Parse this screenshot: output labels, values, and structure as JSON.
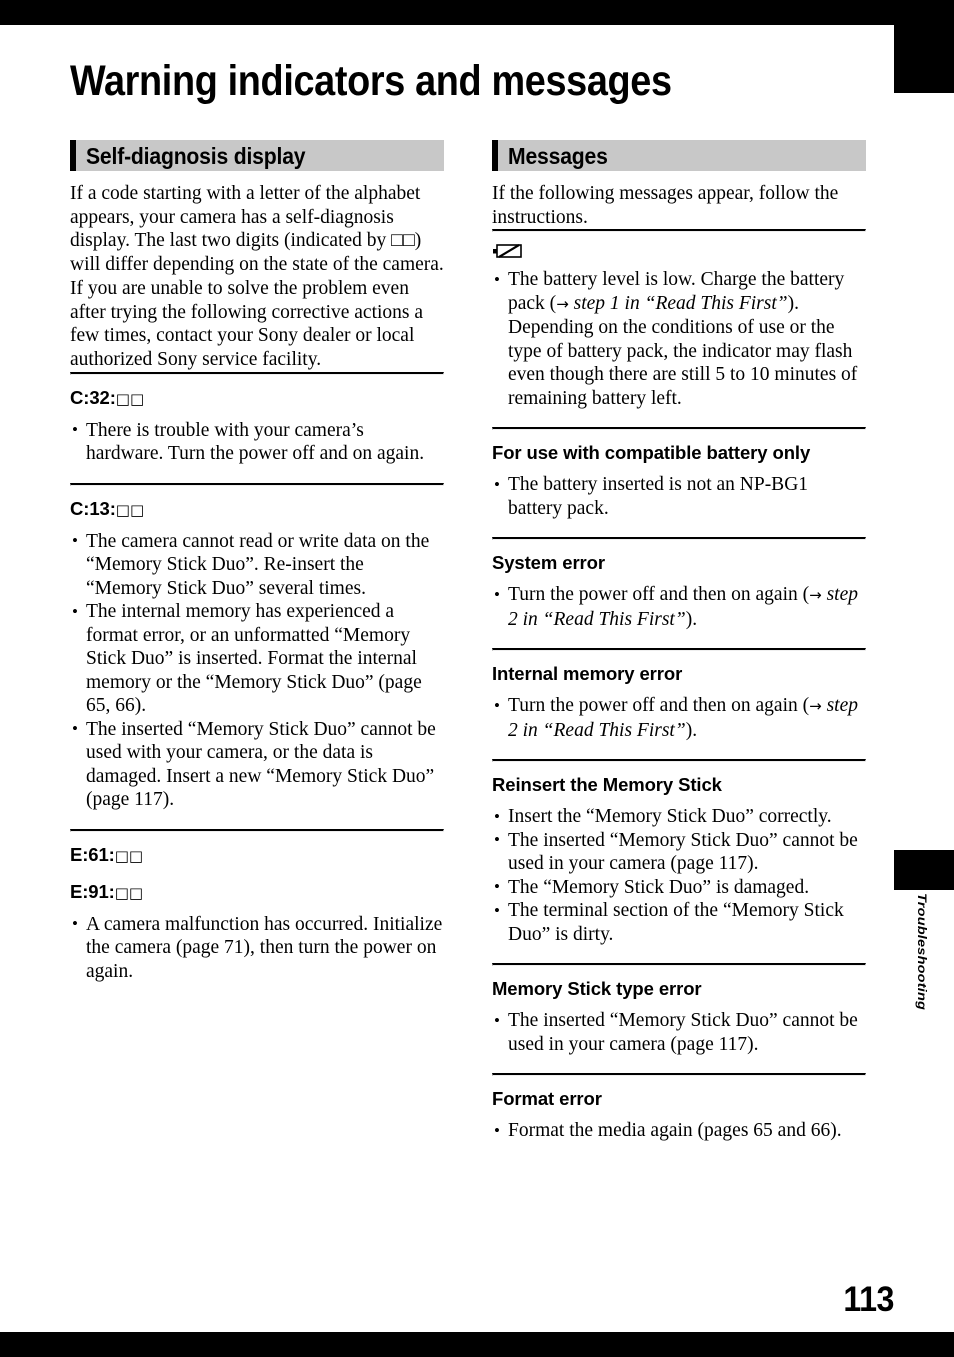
{
  "page": {
    "title": "Warning indicators and messages",
    "number": "113",
    "side_tab_label": "Troubleshooting"
  },
  "left_column": {
    "section": {
      "heading": "Self-diagnosis display",
      "intro_1": "If a code starting with a letter of the alphabet appears, your camera has a self-diagnosis display. The last two digits (indicated by □□) will differ depending on the state of the camera.",
      "intro_2": "If you are unable to solve the problem even after trying the following corrective actions a few times, contact your Sony dealer or local authorized Sony service facility."
    },
    "entries": [
      {
        "code": "C:32:",
        "boxes": "□□",
        "bullets": [
          "There is trouble with your camera’s hardware. Turn the power off and on again."
        ]
      },
      {
        "code": "C:13:",
        "boxes": "□□",
        "bullets": [
          "The camera cannot read or write data on the “Memory Stick Duo”. Re-insert the “Memory Stick Duo” several times.",
          "The internal memory has experienced a format error, or an unformatted “Memory Stick Duo” is inserted. Format the internal memory or the “Memory Stick Duo” (page 65, 66).",
          "The inserted “Memory Stick Duo” cannot be used with your camera, or the data is damaged. Insert a new “Memory Stick Duo” (page 117)."
        ]
      },
      {
        "code": "E:61:",
        "boxes": "□□",
        "bullets": []
      },
      {
        "code": "E:91:",
        "boxes": "□□",
        "bullets": [
          "A camera malfunction has occurred. Initialize the camera (page 71), then turn the power on again."
        ]
      }
    ]
  },
  "right_column": {
    "section": {
      "heading": "Messages",
      "intro": "If the following messages appear, follow the instructions."
    },
    "entries": [
      {
        "icon": "low-battery-icon",
        "title": "",
        "bullets_html": [
          "The battery level is low. Charge the battery pack (<span class=\"arr\">→</span> <i>step 1 in “Read This First”</i>). Depending on the conditions of use or the type of battery pack, the indicator may flash even though there are still 5 to 10 minutes of remaining battery left."
        ]
      },
      {
        "title": "For use with compatible battery only",
        "bullets_html": [
          "The battery inserted is not an NP-BG1 battery pack."
        ]
      },
      {
        "title": "System error",
        "bullets_html": [
          "Turn the power off and then on again (<span class=\"arr\">→</span> <i>step 2 in “Read This First”</i>)."
        ]
      },
      {
        "title": "Internal memory error",
        "bullets_html": [
          "Turn the power off and then on again (<span class=\"arr\">→</span> <i>step 2 in “Read This First”</i>)."
        ]
      },
      {
        "title": "Reinsert the Memory Stick",
        "bullets_html": [
          "Insert the “Memory Stick Duo” correctly.",
          "The inserted “Memory Stick Duo” cannot be used in your camera (page 117).",
          "The “Memory Stick Duo” is damaged.",
          "The terminal section of the “Memory Stick Duo” is dirty."
        ]
      },
      {
        "title": "Memory Stick type error",
        "bullets_html": [
          "The inserted “Memory Stick Duo” cannot be used in your camera (page 117)."
        ]
      },
      {
        "title": "Format error",
        "bullets_html": [
          "Format the media again (pages 65 and 66)."
        ]
      }
    ]
  }
}
